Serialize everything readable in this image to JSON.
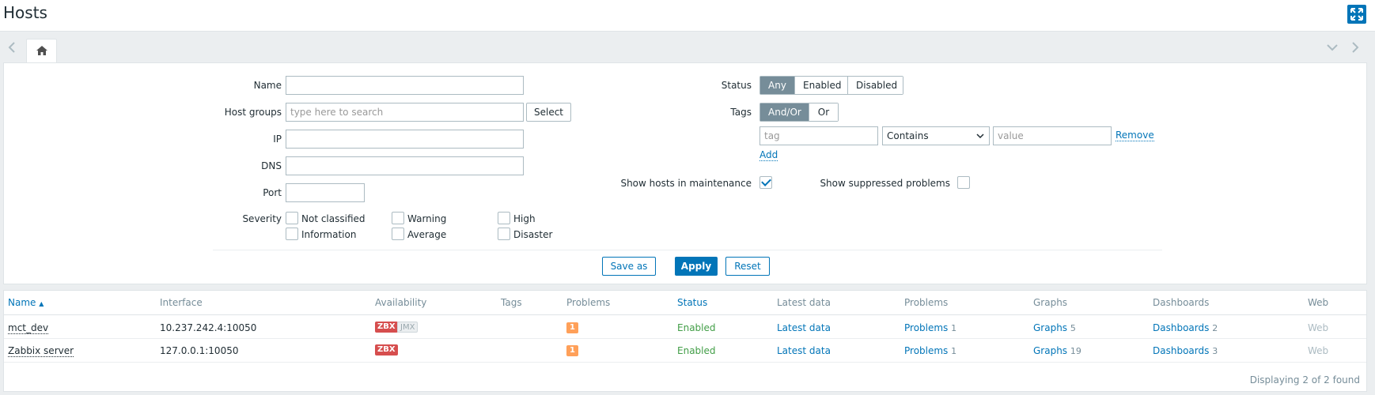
{
  "header": {
    "title": "Hosts"
  },
  "filter": {
    "name_label": "Name",
    "name_value": "",
    "host_groups_label": "Host groups",
    "host_groups_placeholder": "type here to search",
    "select_label": "Select",
    "ip_label": "IP",
    "dns_label": "DNS",
    "port_label": "Port",
    "severity_label": "Severity",
    "severities": [
      {
        "label": "Not classified",
        "checked": false
      },
      {
        "label": "Information",
        "checked": false
      },
      {
        "label": "Warning",
        "checked": false
      },
      {
        "label": "Average",
        "checked": false
      },
      {
        "label": "High",
        "checked": false
      },
      {
        "label": "Disaster",
        "checked": false
      }
    ],
    "status_label": "Status",
    "status_options": [
      "Any",
      "Enabled",
      "Disabled"
    ],
    "status_selected": "Any",
    "tags_label": "Tags",
    "tags_options": [
      "And/Or",
      "Or"
    ],
    "tags_selected": "And/Or",
    "tag_placeholder": "tag",
    "tag_operator": "Contains",
    "value_placeholder": "value",
    "remove_label": "Remove",
    "add_label": "Add",
    "maintenance_label": "Show hosts in maintenance",
    "maintenance_checked": true,
    "suppressed_label": "Show suppressed problems",
    "suppressed_checked": false,
    "save_as_label": "Save as",
    "apply_label": "Apply",
    "reset_label": "Reset"
  },
  "table": {
    "columns": [
      "Name",
      "Interface",
      "Availability",
      "Tags",
      "Problems",
      "Status",
      "Latest data",
      "Problems",
      "Graphs",
      "Dashboards",
      "Web"
    ],
    "sort_indicator": "▲",
    "rows": [
      {
        "name": "mct_dev",
        "interface": "10.237.242.4:10050",
        "availability": [
          "ZBX",
          "JMX"
        ],
        "problems_badge": "1",
        "status": "Enabled",
        "latest_data": "Latest data",
        "problems_link": "Problems",
        "problems_count": "1",
        "graphs_link": "Graphs",
        "graphs_count": "5",
        "dashboards_link": "Dashboards",
        "dashboards_count": "2",
        "web": "Web"
      },
      {
        "name": "Zabbix server",
        "interface": "127.0.0.1:10050",
        "availability": [
          "ZBX"
        ],
        "problems_badge": "1",
        "status": "Enabled",
        "latest_data": "Latest data",
        "problems_link": "Problems",
        "problems_count": "1",
        "graphs_link": "Graphs",
        "graphs_count": "19",
        "dashboards_link": "Dashboards",
        "dashboards_count": "3",
        "web": "Web"
      }
    ],
    "footer": "Displaying 2 of 2 found"
  },
  "icons": {
    "fullscreen": "fullscreen-icon",
    "home": "home-icon",
    "prev": "chevron-left-icon",
    "next": "chevron-right-icon",
    "collapse": "chevron-down-icon",
    "dropdown": "chevron-down-icon"
  },
  "colors": {
    "accent": "#0275b8",
    "zbx_error": "#d64e4e",
    "problem_warning": "#ffa059",
    "enabled": "#429e47"
  }
}
